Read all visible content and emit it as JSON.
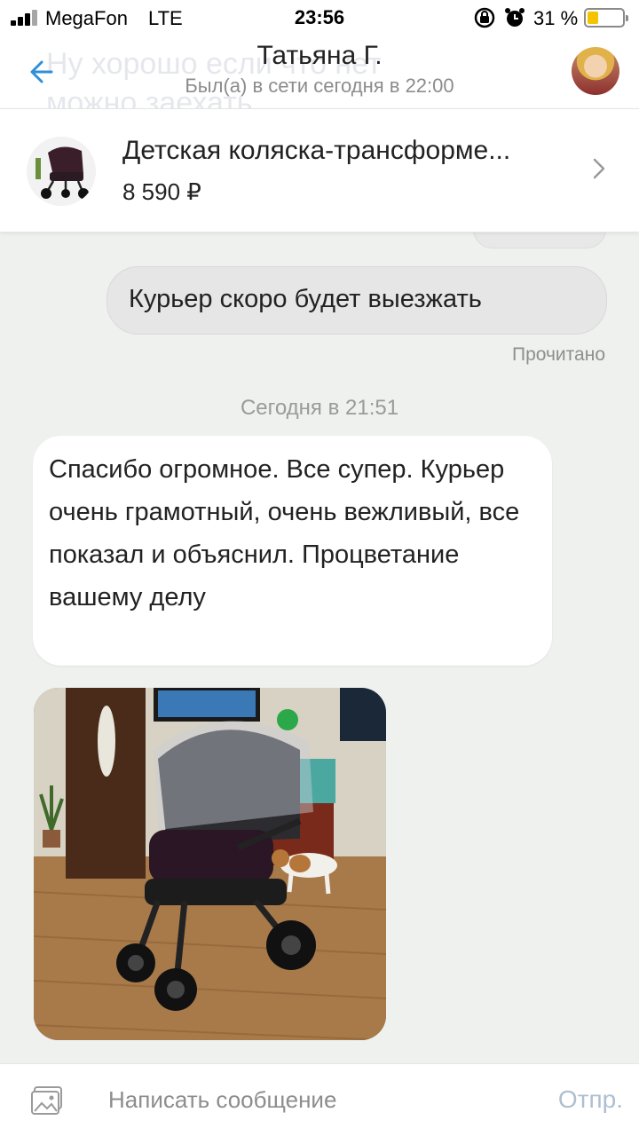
{
  "status_bar": {
    "carrier": "MegaFon",
    "network": "LTE",
    "time": "23:56",
    "battery_percent": "31 %",
    "battery_level": 0.31,
    "battery_color": "#f5c400"
  },
  "header": {
    "ghost_text": "Ну хорошо если что нет можно заехать",
    "title": "Татьяна Г.",
    "subtitle": "Был(а) в сети сегодня в 22:00",
    "accent_color": "#2f8fd9"
  },
  "product": {
    "title": "Детская коляска-трансформе...",
    "price": "8 590 ₽"
  },
  "messages": {
    "outgoing_text": "Курьер скоро будет выезжать",
    "read_status": "Прочитано",
    "date_separator": "Сегодня в 21:51",
    "incoming_text": "Спасибо огромное. Все супер. Курьер очень грамотный, очень вежливый, все показал и объяснил. Процветание вашему делу"
  },
  "composer": {
    "placeholder": "Написать сообщение",
    "send_label": "Отпр."
  },
  "icons": {
    "back": "arrow-left-icon",
    "chevron": "chevron-right-icon",
    "attach": "image-attach-icon",
    "rotation_lock": "rotation-lock-icon",
    "alarm": "alarm-icon"
  }
}
